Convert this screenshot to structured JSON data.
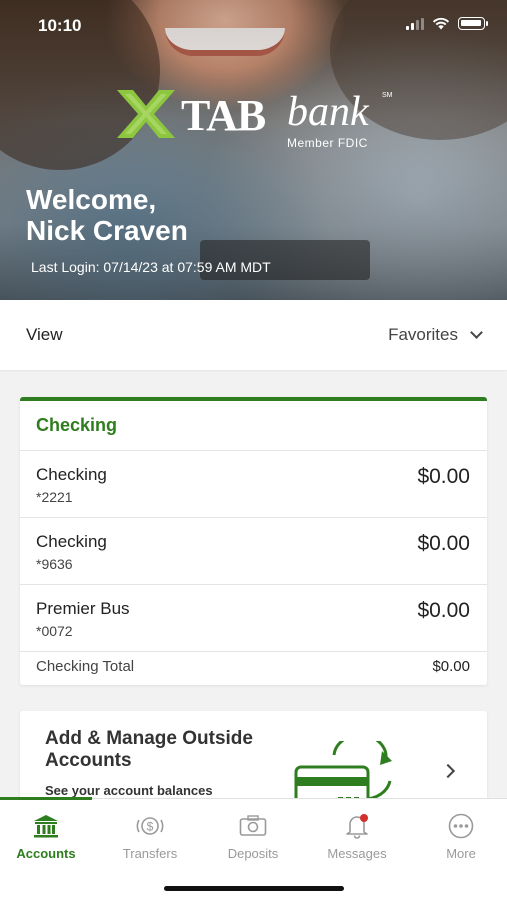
{
  "status_bar": {
    "time": "10:10"
  },
  "brand": {
    "name_primary": "TAB",
    "name_secondary": "bank",
    "service_mark": "SM",
    "tagline": "Member FDIC"
  },
  "welcome": {
    "greeting": "Welcome,",
    "user_name": "Nick Craven",
    "last_login": "Last Login: 07/14/23 at 07:59 AM MDT"
  },
  "view": {
    "label": "View",
    "selected": "Favorites"
  },
  "checking": {
    "title": "Checking",
    "accounts": [
      {
        "name": "Checking",
        "number": "*2221",
        "balance": "$0.00"
      },
      {
        "name": "Checking",
        "number": "*9636",
        "balance": "$0.00"
      },
      {
        "name": "Premier Bus",
        "number": "*0072",
        "balance": "$0.00"
      }
    ],
    "total_label": "Checking Total",
    "total_value": "$0.00"
  },
  "promo": {
    "title": "Add & Manage Outside Accounts",
    "subtitle": "See your account balances"
  },
  "tabs": [
    {
      "label": "Accounts",
      "icon": "bank-icon",
      "active": true
    },
    {
      "label": "Transfers",
      "icon": "dollar-transfer-icon",
      "active": false
    },
    {
      "label": "Deposits",
      "icon": "camera-icon",
      "active": false
    },
    {
      "label": "Messages",
      "icon": "bell-icon",
      "active": false
    },
    {
      "label": "More",
      "icon": "more-dots-icon",
      "active": false
    }
  ],
  "colors": {
    "accent": "#2e7d1e",
    "logo_green": "#8dc63f",
    "notification": "#d32f2f"
  }
}
